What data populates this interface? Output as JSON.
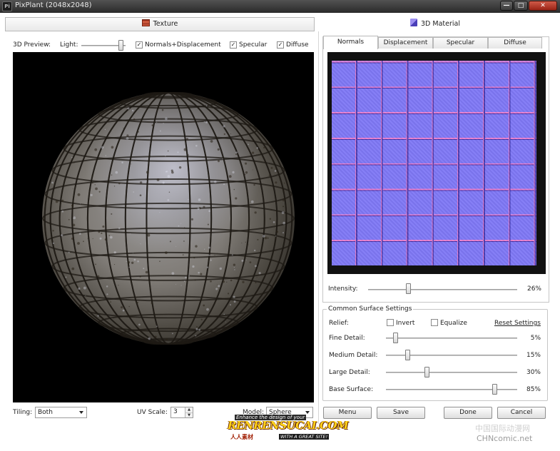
{
  "window": {
    "title": "PixPlant (2048x2048)",
    "app_icon": "Pi",
    "buttons": {
      "minimize": "—",
      "maximize": "□",
      "close": "✕"
    }
  },
  "left": {
    "header": "Texture",
    "preview": {
      "label": "3D Preview:",
      "light_label": "Light:",
      "light_value": 0.95,
      "normals_label": "Normals+Displacement",
      "specular_label": "Specular",
      "diffuse_label": "Diffuse",
      "checkmark": "✓"
    },
    "tiling_label": "Tiling:",
    "tiling_value": "Both",
    "uv_label": "UV Scale:",
    "uv_value": "3",
    "model_label": "Model:",
    "model_value": "Sphere"
  },
  "right": {
    "header": "3D Material",
    "tabs": [
      "Normals",
      "Displacement",
      "Specular",
      "Diffuse"
    ],
    "intensity_label": "Intensity:",
    "intensity_value": "26%",
    "surface": {
      "title": "Common Surface Settings",
      "relief_label": "Relief:",
      "invert_label": "Invert",
      "equalize_label": "Equalize",
      "reset_label": "Reset Settings",
      "rows": [
        {
          "label": "Fine Detail:",
          "value": "5%"
        },
        {
          "label": "Medium Detail:",
          "value": "15%"
        },
        {
          "label": "Large Detail:",
          "value": "30%"
        },
        {
          "label": "Base Surface:",
          "value": "85%"
        }
      ]
    },
    "buttons": {
      "menu": "Menu",
      "save": "Save",
      "done": "Done",
      "cancel": "Cancel"
    }
  },
  "watermark": {
    "tagline": "Enhance the design of your",
    "brand": "RENRENSUCAI.COM",
    "chinese": "人人素材",
    "sub": "WITH A GREAT SITE!",
    "right1": "中国国际动漫网",
    "right2": "CHNcomic.net"
  }
}
